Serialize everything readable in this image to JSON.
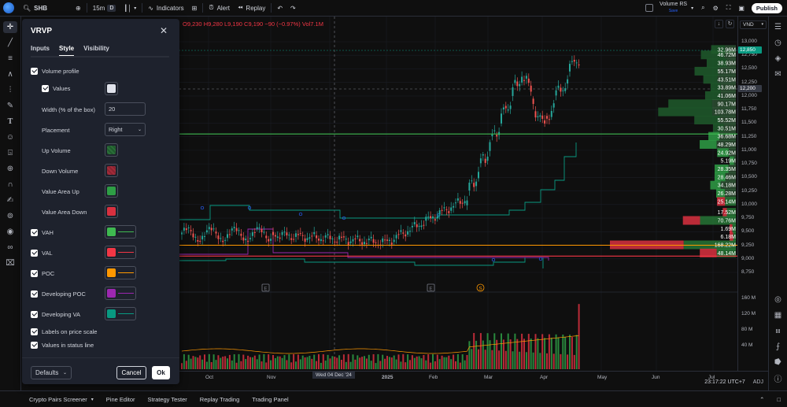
{
  "topbar": {
    "symbol": "SHB",
    "interval": "15m",
    "interval_mode": "D",
    "indicators_label": "Indicators",
    "alert_label": "Alert",
    "replay_label": "Replay",
    "layout_name": "Volume RS",
    "layout_status": "Save",
    "publish_label": "Publish"
  },
  "status_line": {
    "open": "O9,230",
    "high": "H9,280",
    "low": "L9,190",
    "close": "C9,190",
    "change": "−90 (−0.97%)",
    "vol": "Vol7.1M"
  },
  "dialog": {
    "title": "VRVP",
    "tabs": [
      "Inputs",
      "Style",
      "Visibility"
    ],
    "active_tab": "Style",
    "rows": {
      "volume_profile": "Volume profile",
      "values": "Values",
      "width_label": "Width (% of the box)",
      "width_value": "20",
      "placement_label": "Placement",
      "placement_value": "Right",
      "up_volume": "Up Volume",
      "down_volume": "Down Volume",
      "value_area_up": "Value Area Up",
      "value_area_down": "Value Area Down",
      "vah": "VAH",
      "val": "VAL",
      "poc": "POC",
      "developing_poc": "Developing POC",
      "developing_va": "Developing VA",
      "labels_on_price_scale": "Labels on price scale",
      "values_in_status_line": "Values in status line"
    },
    "colors": {
      "values": "#e0e3eb",
      "up_volume": "#1f5a2c",
      "down_volume": "#8a2330",
      "value_area_up": "#2e9e45",
      "value_area_down": "#d9303f",
      "vah": "#3fb950",
      "val": "#f23645",
      "poc": "#ff9800",
      "developing_poc": "#9c27b0",
      "developing_va": "#089981"
    },
    "defaults_label": "Defaults",
    "cancel_label": "Cancel",
    "ok_label": "Ok"
  },
  "price_axis": {
    "currency": "VND",
    "ticks": [
      "13,000",
      "12,750",
      "12,500",
      "12,250",
      "12,000",
      "11,750",
      "11,500",
      "11,250",
      "11,000",
      "10,750",
      "10,500",
      "10,250",
      "10,000",
      "9,750",
      "9,500",
      "9,250",
      "9,000",
      "8,750"
    ],
    "last_price": "12,850",
    "crosshair_price": "12,200",
    "volume_ticks": [
      "160 M",
      "120 M",
      "80 M",
      "40 M"
    ]
  },
  "time_axis": {
    "labels": [
      "Oct",
      "Nov",
      "2025",
      "Feb",
      "Mar",
      "Apr",
      "May",
      "Jun",
      "Jul"
    ],
    "crosshair_date": "Wed 04 Dec '24",
    "clock": "23:17:22 UTC+7",
    "adj": "ADJ"
  },
  "markers": {
    "earnings": "E",
    "dividend": "S"
  },
  "bottombar": {
    "items": [
      "Crypto Pairs Screener",
      "Pine Editor",
      "Strategy Tester",
      "Replay Trading",
      "Trading Panel"
    ]
  },
  "chart_data": {
    "type": "bar",
    "title": "",
    "xlabel": "",
    "ylabel": "",
    "profile_labels": [
      "32.96M",
      "46.72M",
      "38.93M",
      "55.17M",
      "43.51M",
      "33.89M",
      "41.06M",
      "90.17M",
      "103.78M",
      "55.52M",
      "30.51M",
      "36.68M",
      "48.29M",
      "24.92M",
      "5.19M",
      "28.35M",
      "28.46M",
      "34.18M",
      "26.28M",
      "25.14M",
      "17.52M",
      "70.76M",
      "1.69M",
      "6.18M",
      "168.22M",
      "48.14M"
    ],
    "profile_values_m": [
      32.96,
      46.72,
      38.93,
      55.17,
      43.51,
      33.89,
      41.06,
      90.17,
      103.78,
      55.52,
      30.51,
      36.68,
      48.29,
      24.92,
      5.19,
      28.35,
      28.46,
      34.18,
      26.28,
      25.14,
      17.52,
      70.76,
      1.69,
      6.18,
      168.22,
      48.14
    ],
    "profile_price_levels": [
      12850,
      12750,
      12600,
      12450,
      12300,
      12150,
      12000,
      11850,
      11700,
      11550,
      11400,
      11250,
      11100,
      10950,
      10800,
      10650,
      10500,
      10350,
      10200,
      10050,
      9850,
      9700,
      9550,
      9400,
      9250,
      9100
    ],
    "ylim": [
      8750,
      13000
    ],
    "vah_price": 11300,
    "val_price": 9050,
    "poc_price": 9250
  }
}
